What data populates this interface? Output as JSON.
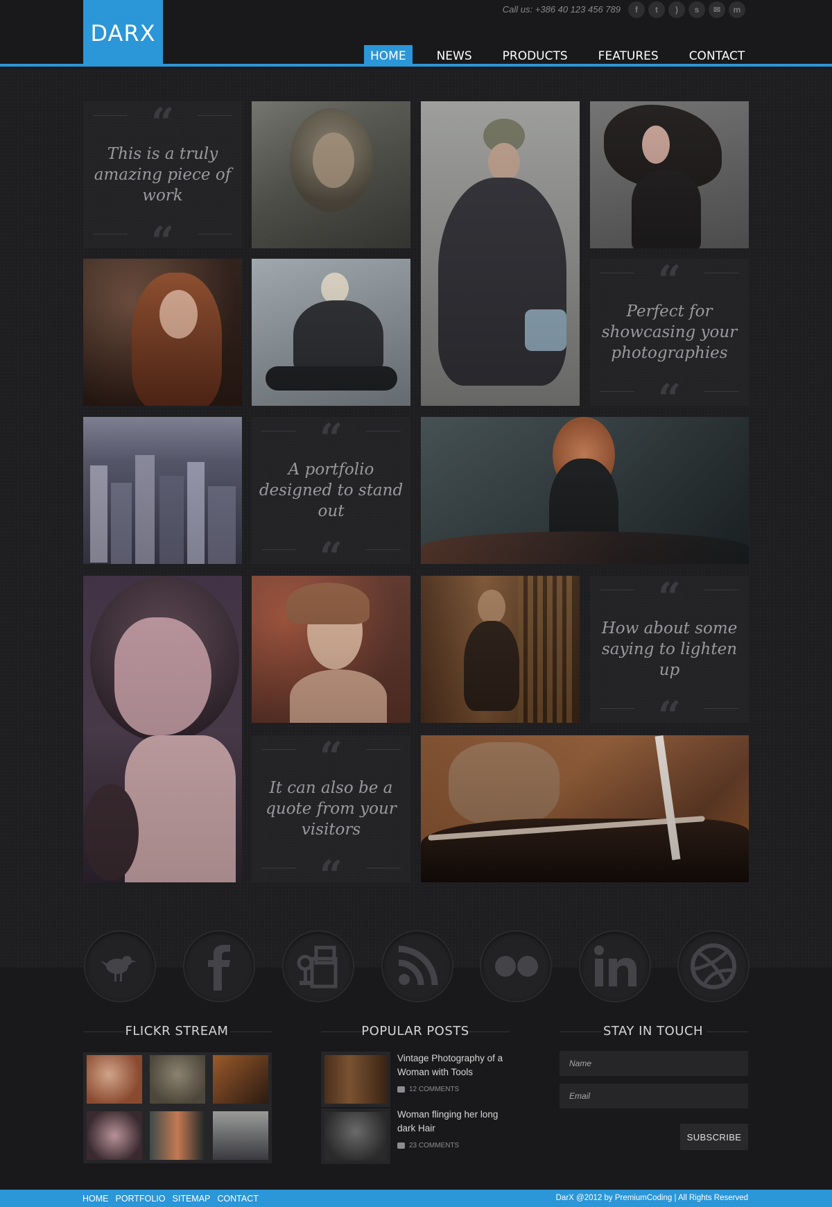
{
  "header": {
    "logo": "DARX",
    "call_us": "Call us: +386 40 123 456 789",
    "social_icons": [
      "facebook-icon",
      "twitter-icon",
      "rss-icon",
      "skype-icon",
      "mail-icon",
      "myspace-icon"
    ],
    "nav": [
      {
        "label": "HOME",
        "active": true
      },
      {
        "label": "NEWS",
        "active": false
      },
      {
        "label": "PRODUCTS",
        "active": false
      },
      {
        "label": "FEATURES",
        "active": false
      },
      {
        "label": "CONTACT",
        "active": false
      }
    ]
  },
  "quotes": [
    "This is a truly amazing piece of work",
    "Perfect for showcasing your photographies",
    "A portfolio designed to stand out",
    "How about some saying to lighten up",
    "It can also be a quote from your visitors"
  ],
  "social_circles": [
    "twitter-icon",
    "facebook-icon",
    "myspace-icon",
    "rss-icon",
    "flickr-icon",
    "linkedin-icon",
    "dribbble-icon"
  ],
  "footer": {
    "flickr_title": "FLICKR STREAM",
    "posts_title": "POPULAR POSTS",
    "touch_title": "STAY IN TOUCH",
    "posts": [
      {
        "title": "Vintage Photography of a Woman with Tools",
        "comments": "12 COMMENTS"
      },
      {
        "title": "Woman flinging her long dark Hair",
        "comments": "23 COMMENTS"
      }
    ],
    "name_placeholder": "Name",
    "email_placeholder": "Email",
    "subscribe_label": "SUBSCRIBE"
  },
  "bottom": {
    "links": [
      "HOME",
      "PORTFOLIO",
      "SITEMAP",
      "CONTACT"
    ],
    "copyright": "DarX @2012 by PremiumCoding | All Rights Reserved"
  },
  "colors": {
    "accent": "#2b96d8",
    "background": "#1c1c1f"
  }
}
